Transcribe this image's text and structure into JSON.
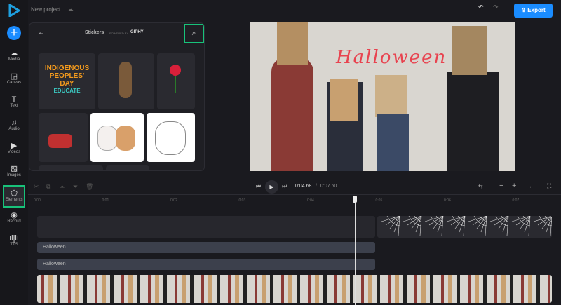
{
  "header": {
    "project_title": "New project",
    "export_label": "Export"
  },
  "sidebar": {
    "items": [
      {
        "label": "Media",
        "icon": "upload-cloud-icon",
        "glyph": "☁"
      },
      {
        "label": "Canvas",
        "icon": "canvas-icon",
        "glyph": "◲"
      },
      {
        "label": "Text",
        "icon": "text-icon",
        "glyph": "T"
      },
      {
        "label": "Audio",
        "icon": "music-icon",
        "glyph": "♫"
      },
      {
        "label": "Videos",
        "icon": "video-icon",
        "glyph": "▶"
      },
      {
        "label": "Images",
        "icon": "image-icon",
        "glyph": "▨"
      },
      {
        "label": "Elements",
        "icon": "shapes-icon",
        "glyph": "⬠",
        "selected": true
      },
      {
        "label": "Record",
        "icon": "record-icon",
        "glyph": "◉"
      },
      {
        "label": "TTS",
        "icon": "waveform-icon",
        "glyph": "ıl|lı"
      }
    ]
  },
  "stickers": {
    "title": "Stickers",
    "powered_by": "POWERED BY",
    "brand": "GIPHY",
    "sticker_text": "INDIGENOUS PEOPLES' DAY",
    "sticker_sub": "EDUCATE"
  },
  "preview": {
    "overlay_text": "Halloween"
  },
  "playback": {
    "current_time": "0:04.68",
    "separator": "/",
    "total_time": "0:07.60"
  },
  "ruler": {
    "ticks": [
      "0:00",
      "0:01",
      "0:02",
      "0:03",
      "0:04",
      "0:05",
      "0:06",
      "0:07"
    ]
  },
  "tracks": {
    "text1": "Halloween",
    "text2": "Halloween"
  },
  "colors": {
    "accent": "#1a8cff",
    "highlight": "#18c27a",
    "text_overlay": "#e8434f"
  }
}
